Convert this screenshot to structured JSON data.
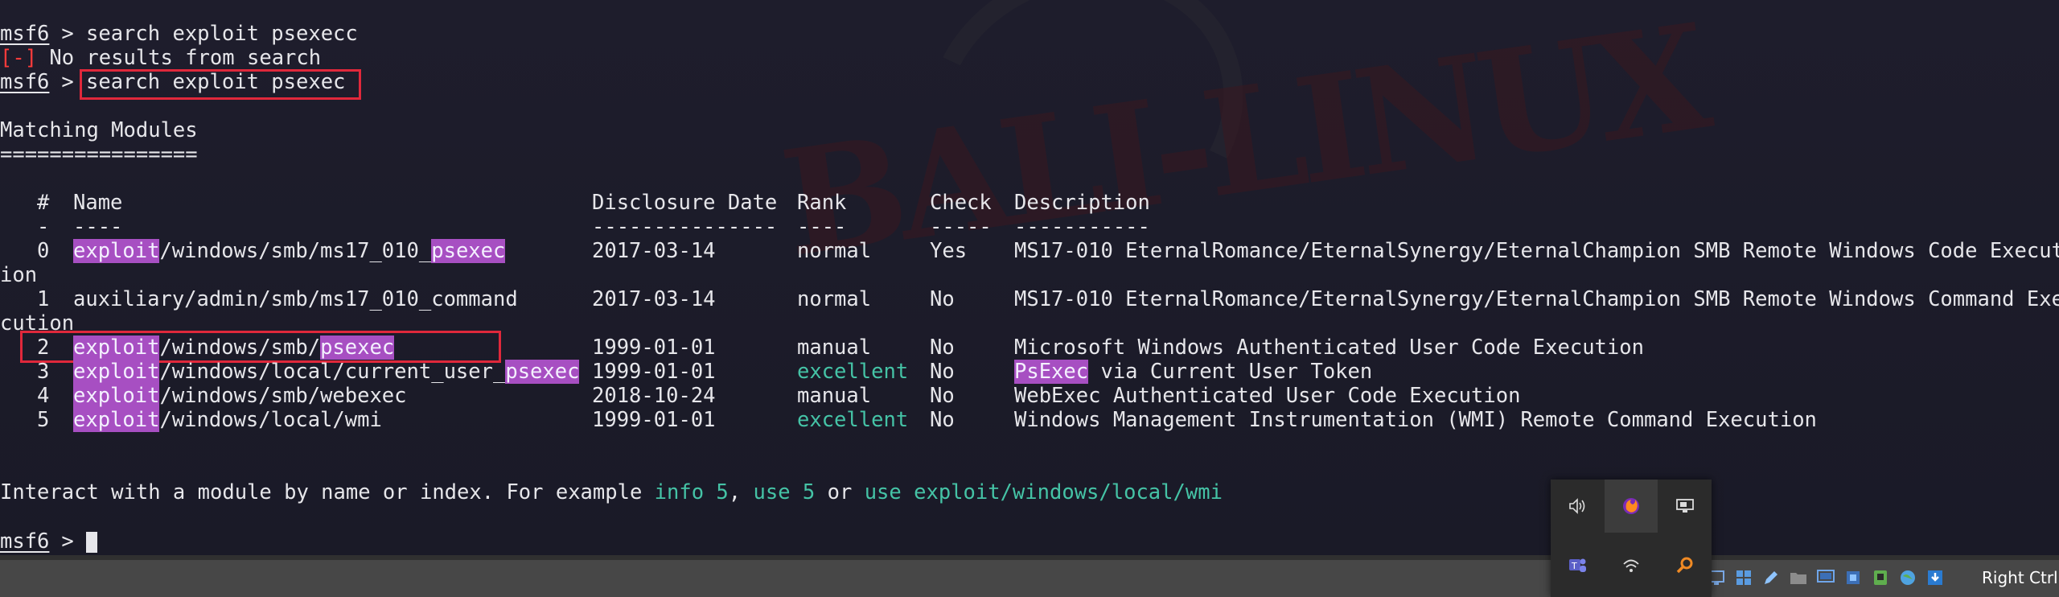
{
  "terminal": {
    "prompt": "msf6",
    "prompt_sep": " > ",
    "commands": {
      "first": "search exploit psexecc",
      "second": "search exploit psexec"
    },
    "error_tag": "[-]",
    "error_text": " No results from search",
    "matching_title": "Matching Modules",
    "matching_underline": "================",
    "table": {
      "headers": {
        "num": "#",
        "name": "Name",
        "date": "Disclosure Date",
        "rank": "Rank",
        "check": "Check",
        "desc": "Description"
      },
      "header_underlines": {
        "num": "-",
        "name": "----",
        "date": "---------------",
        "rank": "----",
        "check": "-----",
        "desc": "-----------"
      },
      "rows": [
        {
          "num": "0",
          "name_parts": [
            "exploit",
            "/windows/smb/ms17_010_",
            "psexec"
          ],
          "date": "2017-03-14",
          "rank": "normal",
          "check": "Yes",
          "desc": "MS17-010 EternalRomance/EternalSynergy/EternalChampion SMB Remote Windows Code Execut",
          "wrap": "ion"
        },
        {
          "num": "1",
          "name": "auxiliary/admin/smb/ms17_010_command",
          "date": "2017-03-14",
          "rank": "normal",
          "check": "No",
          "desc": "MS17-010 EternalRomance/EternalSynergy/EternalChampion SMB Remote Windows Command Exe",
          "wrap": "cution"
        },
        {
          "num": "2",
          "name_parts": [
            "exploit",
            "/windows/smb/",
            "psexec"
          ],
          "date": "1999-01-01",
          "rank": "manual",
          "check": "No",
          "desc": "Microsoft Windows Authenticated User Code Execution"
        },
        {
          "num": "3",
          "name_parts": [
            "exploit",
            "/windows/local/current_user_",
            "psexec"
          ],
          "date": "1999-01-01",
          "rank": "excellent",
          "check": "No",
          "desc_parts": [
            "PsExec",
            " via Current User Token"
          ]
        },
        {
          "num": "4",
          "name_parts": [
            "exploit",
            "/windows/smb/webexec"
          ],
          "date": "2018-10-24",
          "rank": "manual",
          "check": "No",
          "desc": "WebExec Authenticated User Code Execution"
        },
        {
          "num": "5",
          "name_parts": [
            "exploit",
            "/windows/local/wmi"
          ],
          "date": "1999-01-01",
          "rank": "excellent",
          "check": "No",
          "desc": "Windows Management Instrumentation (WMI) Remote Command Execution"
        }
      ]
    },
    "interact": {
      "lead": "Interact with a module by name or index. For example ",
      "info": "info 5",
      "sep1": ", ",
      "use_num": "use 5",
      "or": " or ",
      "use_path": "use exploit/windows/local/wmi"
    }
  },
  "taskbar": {
    "host_key_label": "Right Ctrl",
    "icons": [
      "monitor-icon",
      "windows-icon",
      "pencil-icon",
      "folder-icon",
      "display-icon",
      "network-icon",
      "usb-icon",
      "globe-icon",
      "download-icon"
    ]
  },
  "tray": {
    "icons": [
      "speaker-icon",
      "firefox-icon",
      "network-monitor-icon",
      "teams-icon",
      "wifi-icon",
      "search-icon"
    ]
  },
  "colors": {
    "background": "#1c1b29",
    "text": "#e6e6ea",
    "highlight": "#a74fc2",
    "teal": "#45c3a6",
    "error": "#ff3b3b",
    "annotation_box": "#e0283b"
  }
}
